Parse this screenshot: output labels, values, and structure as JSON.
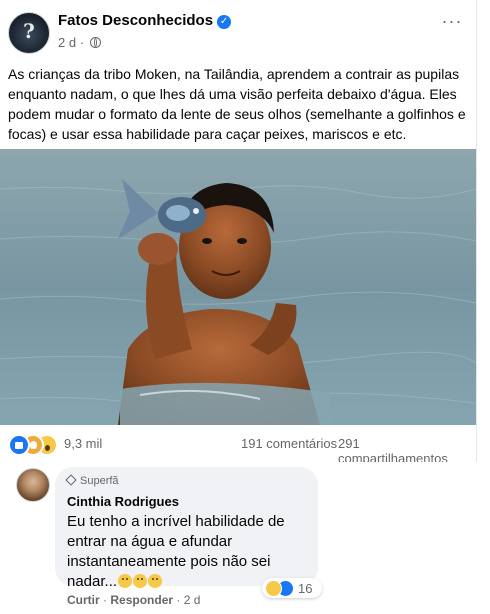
{
  "post": {
    "page_name": "Fatos Desconhecidos",
    "time": "2 d",
    "text": "As crianças da tribo Moken, na Tailândia, aprendem a contrair as pupilas enquanto nadam, o que lhes dá uma visão perfeita debaixo d'água. Eles podem mudar o formato da lente de seus olhos (semelhante a golfinhos e focas) e usar essa habilidade para caçar peixes, mariscos e etc.",
    "more_label": "···",
    "verified_mark": "✓"
  },
  "stats": {
    "reactions_count": "9,3 mil",
    "comments_count": "191 comentários",
    "shares_count": "291 compartilhamentos"
  },
  "comment": {
    "badge": "Superfã",
    "author": "Cinthia Rodrigues",
    "text": "Eu tenho a incrível habilidade de entrar na água e afundar instantaneamente pois não sei nadar...",
    "reactions_count": "16",
    "actions": {
      "like": "Curtir",
      "reply": "Responder",
      "time": "2 d",
      "separator": "·"
    }
  },
  "icons": {
    "avatar": "page-avatar",
    "verified": "verified-badge-icon",
    "privacy": "globe-icon",
    "reactions": [
      "like-icon",
      "love-icon",
      "wow-icon"
    ]
  },
  "colors": {
    "accent": "#1877f2",
    "secondary_text": "#65676b",
    "bubble_bg": "#f0f2f5"
  }
}
